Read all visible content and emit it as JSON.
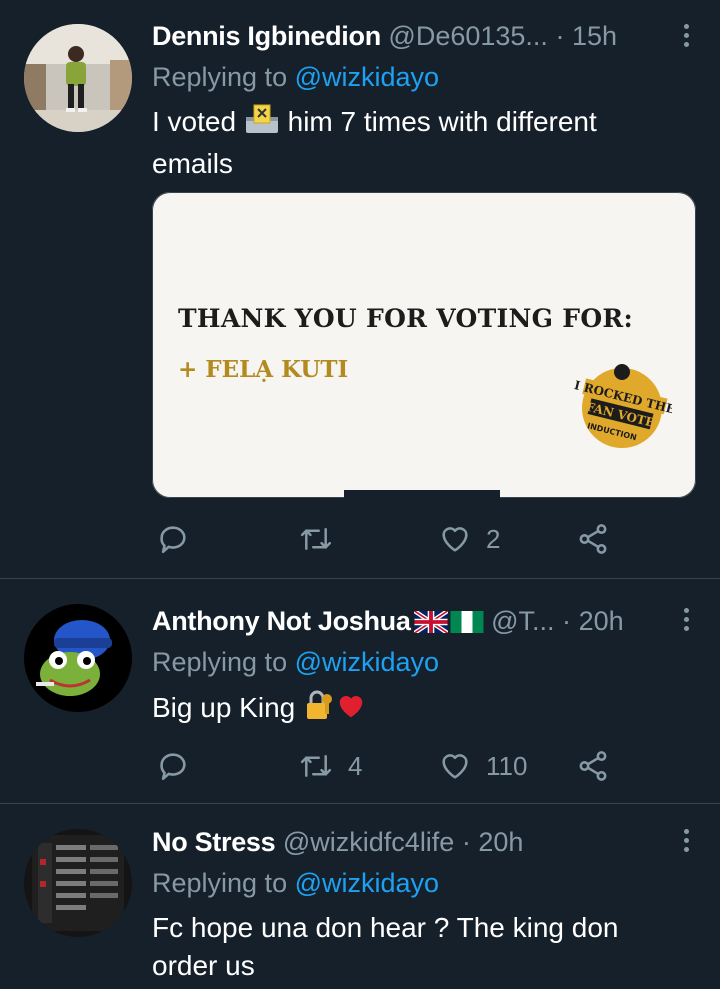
{
  "tweets": [
    {
      "name": "Dennis Igbinedion",
      "handle": "@De60135...",
      "separator": "·",
      "time": "15h",
      "replying_prefix": "Replying to",
      "replying_to": "@wizkidayo",
      "text_a": "I voted",
      "text_b": "him 7 times with different",
      "text_c": "emails",
      "media": {
        "headline": "THANK YOU FOR VOTING FOR:",
        "nominee": "+ FELẠ KUTI",
        "badge_line1": "I ROCKED THE",
        "badge_line2": "FAN VOTE",
        "badge_line3": "INDUCTION"
      },
      "actions": {
        "reply": "",
        "retweet": "",
        "like": "2"
      }
    },
    {
      "name": "Anthony Not Joshua",
      "handle": "@T...",
      "separator": "·",
      "time": "20h",
      "replying_prefix": "Replying to",
      "replying_to": "@wizkidayo",
      "text_a": "Big up King",
      "actions": {
        "reply": "",
        "retweet": "4",
        "like": "110"
      }
    },
    {
      "name": "No Stress",
      "handle": "@wizkidfc4life",
      "separator": "·",
      "time": "20h",
      "replying_prefix": "Replying to",
      "replying_to": "@wizkidayo",
      "text_a": "Fc hope una don hear ? The king don",
      "text_b": "order us"
    }
  ],
  "icons": {
    "reply": "speech-bubble-icon",
    "retweet": "retweet-icon",
    "like": "heart-icon",
    "share": "share-icon",
    "more": "kebab-menu-icon"
  },
  "colors": {
    "background": "#15202b",
    "secondary_text": "#8899a6",
    "link": "#1da1f2",
    "divider": "#38444d"
  }
}
